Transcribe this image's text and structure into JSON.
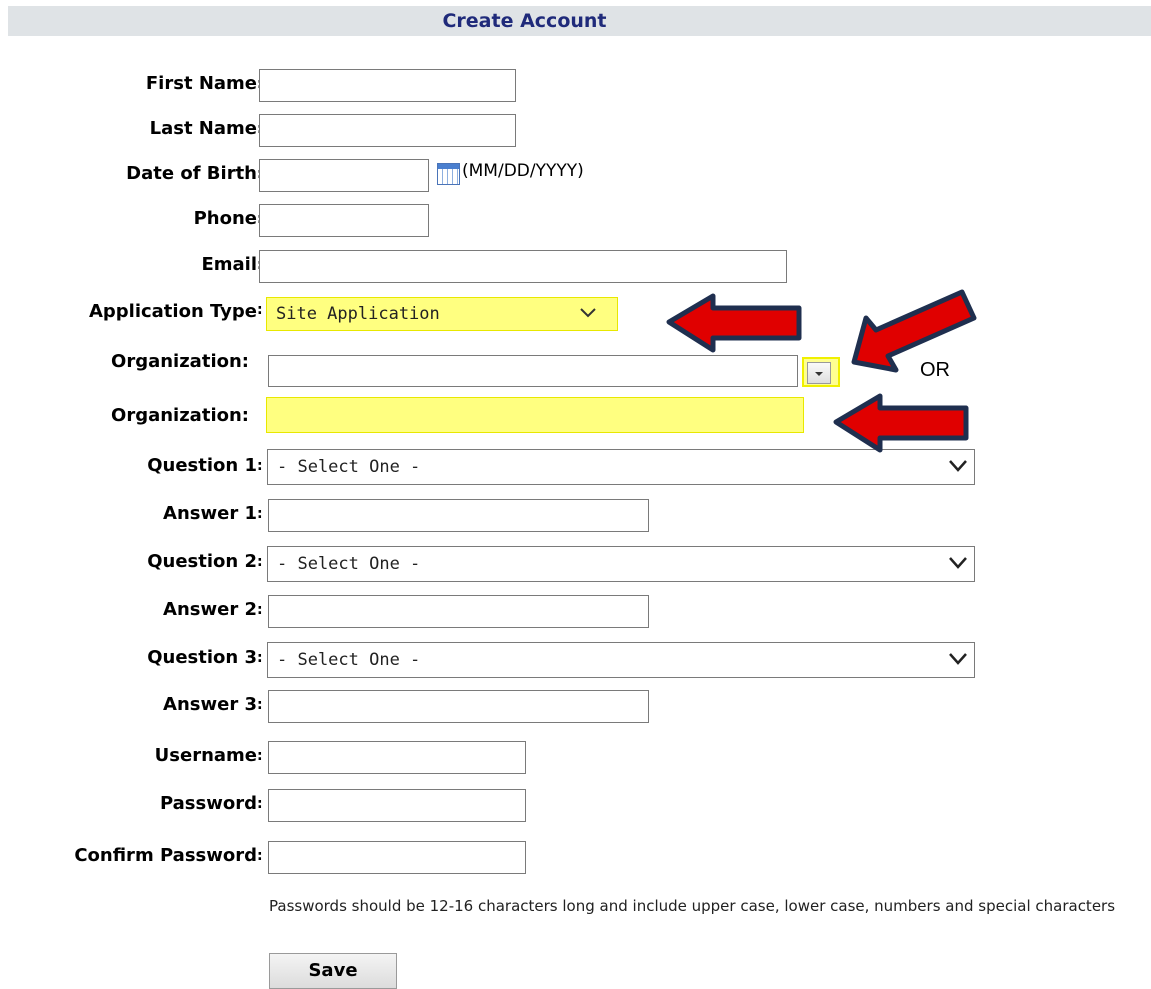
{
  "header": {
    "title": "Create Account"
  },
  "form": {
    "first_name_label": "First Name",
    "last_name_label": "Last Name",
    "dob_label": "Date of Birth",
    "dob_hint": "(MM/DD/YYYY)",
    "phone_label": "Phone",
    "email_label": "Email",
    "app_type_label": "Application Type",
    "app_type_value": "Site Application",
    "org_label_1": "Organization:",
    "org_label_2": "Organization:",
    "question1_label": "Question 1",
    "question1_value": "- Select One -",
    "answer1_label": "Answer 1",
    "question2_label": "Question 2",
    "question2_value": "- Select One -",
    "answer2_label": "Answer 2",
    "question3_label": "Question 3",
    "question3_value": "- Select One -",
    "answer3_label": "Answer 3",
    "username_label": "Username",
    "password_label": "Password",
    "confirm_password_label": "Confirm Password",
    "password_note": "Passwords should be 12-16 characters long and include upper case, lower case, numbers and special characters",
    "save_label": "Save"
  },
  "annotations": {
    "or_text": "OR",
    "arrow_color": "#e00000",
    "arrow_outline": "#1f2f4f",
    "highlight_color": "#ffff80"
  },
  "icons": {
    "calendar": "calendar-icon",
    "chevron": "chevron-down-icon"
  }
}
